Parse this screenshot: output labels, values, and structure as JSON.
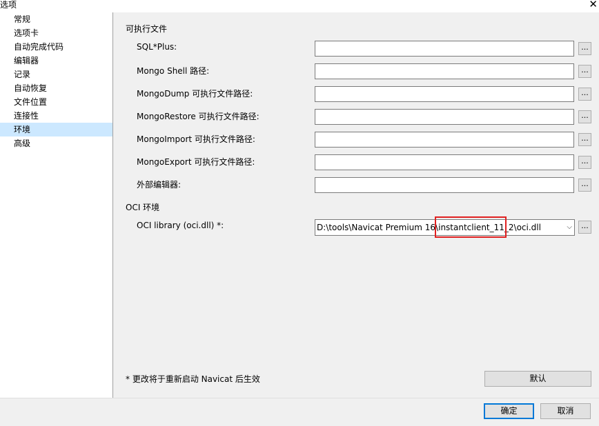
{
  "window": {
    "title": "选项",
    "close_glyph": "✕"
  },
  "sidebar": {
    "items": [
      {
        "label": "常规"
      },
      {
        "label": "选项卡"
      },
      {
        "label": "自动完成代码"
      },
      {
        "label": "编辑器"
      },
      {
        "label": "记录"
      },
      {
        "label": "自动恢复"
      },
      {
        "label": "文件位置"
      },
      {
        "label": "连接性"
      },
      {
        "label": "环境",
        "selected": true
      },
      {
        "label": "高级"
      }
    ]
  },
  "executables": {
    "section_title": "可执行文件",
    "rows": [
      {
        "label": "SQL*Plus:",
        "value": ""
      },
      {
        "label": "Mongo Shell 路径:",
        "value": ""
      },
      {
        "label": "MongoDump 可执行文件路径:",
        "value": ""
      },
      {
        "label": "MongoRestore 可执行文件路径:",
        "value": ""
      },
      {
        "label": "MongoImport 可执行文件路径:",
        "value": ""
      },
      {
        "label": "MongoExport 可执行文件路径:",
        "value": ""
      },
      {
        "label": "外部编辑器:",
        "value": ""
      }
    ],
    "browse_label": "..."
  },
  "oci": {
    "section_title": "OCI 环境",
    "library_label": "OCI library (oci.dll) *:",
    "library_value": "D:\\tools\\Navicat Premium 16\\instantclient_11_2\\oci.dll",
    "browse_label": "...",
    "dropdown_glyph": "⌵"
  },
  "footer_note": "* 更改将于重新启动 Navicat 后生效",
  "buttons": {
    "default_label": "默认",
    "ok_label": "确定",
    "cancel_label": "取消"
  },
  "colors": {
    "selection": "#cce8ff",
    "highlight_box": "#e02020",
    "default_button_border": "#0078d7"
  }
}
